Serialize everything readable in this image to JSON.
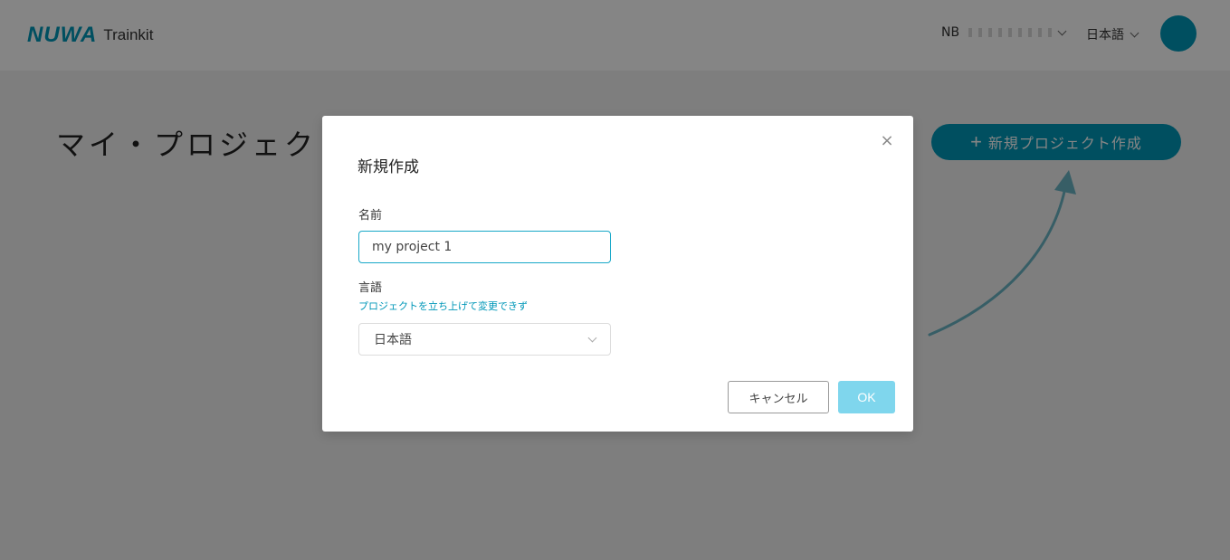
{
  "header": {
    "logo_mark": "NUWA",
    "logo_text": "Trainkit",
    "user_prefix": "NB",
    "language": "日本語"
  },
  "page": {
    "title": "マイ・プロジェクト",
    "new_project_label": "新規プロジェクト作成",
    "new_project_icon": "plus-icon"
  },
  "modal": {
    "title": "新規作成",
    "close_icon": "close-icon",
    "name_label": "名前",
    "name_value": "my project 1",
    "language_label": "言語",
    "language_hint": "プロジェクトを立ち上げて変更できず",
    "language_value": "日本語",
    "cancel_label": "キャンセル",
    "ok_label": "OK"
  },
  "colors": {
    "accent": "#0097b8",
    "ok_disabled": "#7fd6ed"
  }
}
